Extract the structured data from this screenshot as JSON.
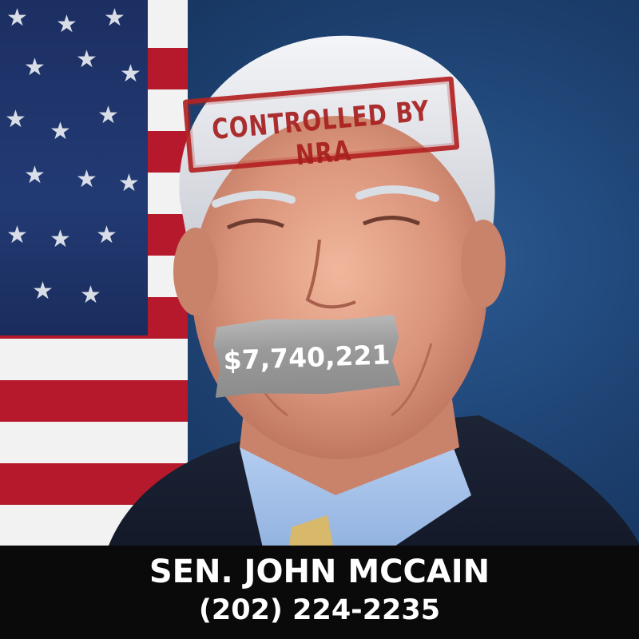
{
  "stamp": {
    "text": "CONTROLLED BY NRA",
    "color": "#b32222"
  },
  "tape": {
    "text": "$7,740,221"
  },
  "caption": {
    "name": "SEN. JOHN MCCAIN",
    "phone": "(202) 224-2235"
  },
  "colors": {
    "background": "#1c3f6e",
    "caption_bar": "#0a0a0a",
    "stamp_red": "#b32222",
    "tape_gray": "#9a9a9a"
  }
}
